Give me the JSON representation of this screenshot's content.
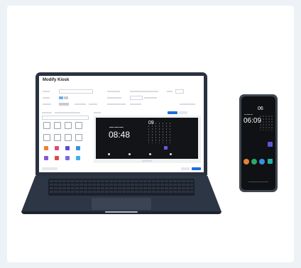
{
  "laptop": {
    "page_title": "Modify Kiosk",
    "preview": {
      "clock_time": "08:48",
      "calendar_day": "09"
    }
  },
  "phone": {
    "clock_time": "06:09",
    "calendar_day": "06"
  },
  "colors": {
    "accent": "#1e6fd9",
    "device_body": "#2a3240",
    "screen_dark": "#121417"
  }
}
